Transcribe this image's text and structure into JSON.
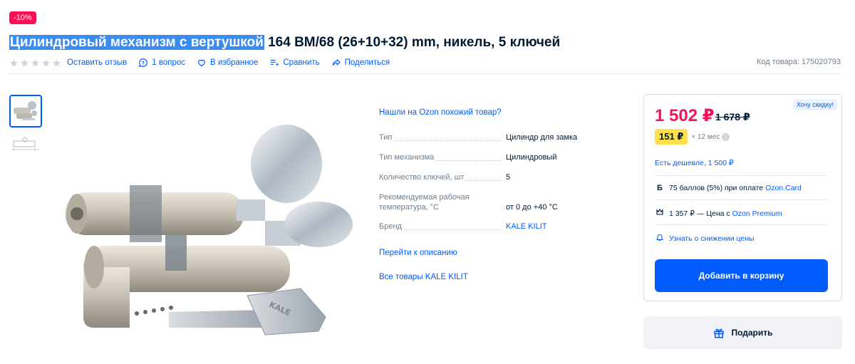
{
  "badge": {
    "discount": "-10%"
  },
  "product": {
    "title_highlight": "Цилиндровый механизм с вертушкой",
    "title_rest": " 164 BM/68 (26+10+32) mm, никель, 5 ключей",
    "sku": "Код товара: 175020793"
  },
  "meta": {
    "rating_stars": 5,
    "review_label": "Оставить отзыв",
    "questions_label": "1 вопрос",
    "favorite_label": "В избранное",
    "compare_label": "Сравнить",
    "share_label": "Поделиться"
  },
  "details": {
    "similar_link": "Нашли на Ozon похожий товар?",
    "specs": [
      {
        "key": "Тип",
        "value": "Цилиндр для замка"
      },
      {
        "key": "Тип механизма",
        "value": "Цилиндровый"
      },
      {
        "key": "Количество ключей, шт",
        "value": "5"
      },
      {
        "key": "Рекомендуемая рабочая температура, °C",
        "value": "от 0 до +40 °C"
      },
      {
        "key": "Бренд",
        "value": "KALE KILIT"
      }
    ],
    "to_description": "Перейти к описанию",
    "all_goods": "Все товары KALE KILIT"
  },
  "buy": {
    "want_discount": "Хочу скидку!",
    "price": "1 502 ₽",
    "old_price": "1 678 ₽",
    "installment_value": "151 ₽",
    "installment_months": "× 12 мес",
    "cheaper": "Есть дешевле, 1 500 ₽",
    "points_icon": "Б",
    "points_text": "75 баллов (5%) при оплате ",
    "points_link": "Ozon.Card",
    "premium_text": "1 357 ₽ — Цена с ",
    "premium_link": "Ozon Premium",
    "notify_text": "Узнать о снижении цены",
    "add_to_cart": "Добавить в корзину",
    "gift": "Подарить"
  },
  "colors": {
    "accent": "#005bff",
    "sale": "#f91155",
    "installment": "#ffe04b"
  }
}
